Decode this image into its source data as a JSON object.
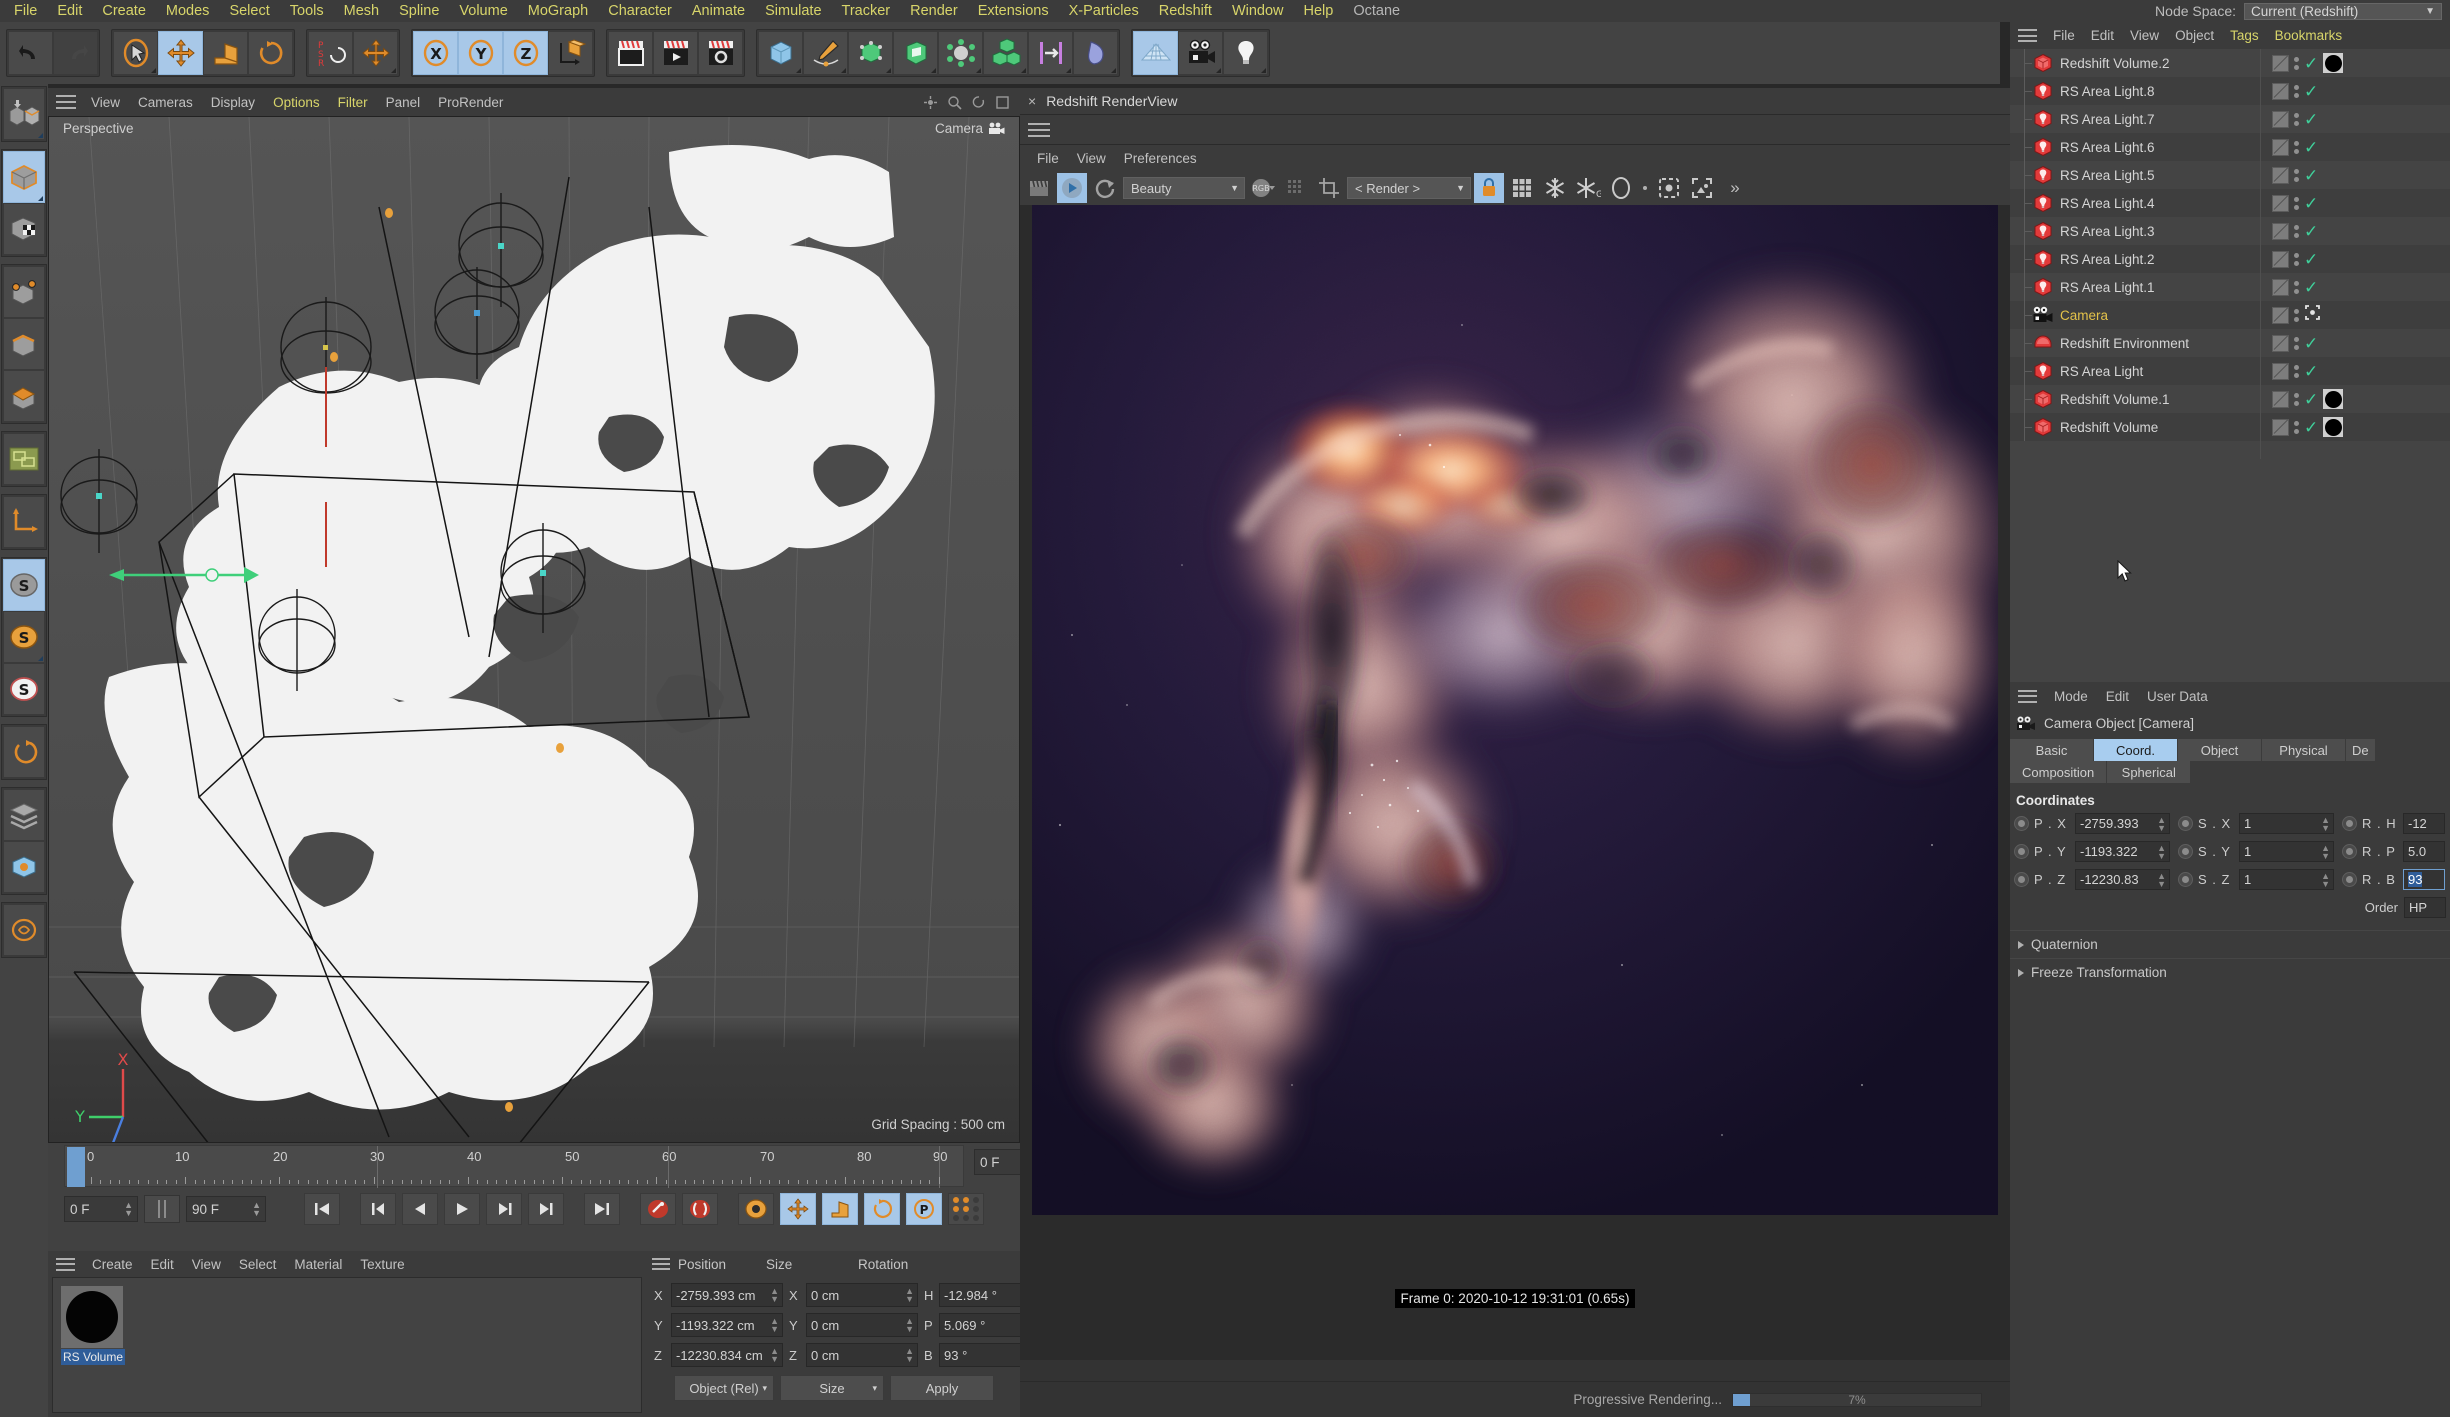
{
  "menubar": {
    "items": [
      "File",
      "Edit",
      "Create",
      "Modes",
      "Select",
      "Tools",
      "Mesh",
      "Spline",
      "Volume",
      "MoGraph",
      "Character",
      "Animate",
      "Simulate",
      "Tracker",
      "Render",
      "Extensions",
      "X-Particles",
      "Redshift",
      "Window",
      "Help",
      "Octane"
    ],
    "node_space_label": "Node Space:",
    "node_space_value": "Current (Redshift)"
  },
  "viewport": {
    "menu": [
      "View",
      "Cameras",
      "Display",
      "Options",
      "Filter",
      "Panel",
      "ProRender"
    ],
    "projection": "Perspective",
    "camera": "Camera",
    "grid_spacing": "Grid Spacing : 500 cm",
    "axis_x": "X",
    "axis_y": "Y",
    "axis_z": "Z"
  },
  "timeline": {
    "ticks": [
      "0",
      "10",
      "20",
      "30",
      "40",
      "50",
      "60",
      "70",
      "80",
      "90"
    ],
    "current_frame_right": "0 F",
    "start_frame": "0 F",
    "end_frame": "90 F"
  },
  "material_manager": {
    "menu": [
      "Create",
      "Edit",
      "View",
      "Select",
      "Material",
      "Texture"
    ],
    "materials": [
      {
        "name": "RS Volume",
        "color": "#040404"
      }
    ]
  },
  "coordinate_manager": {
    "headers": [
      "Position",
      "Size",
      "Rotation"
    ],
    "rows": [
      {
        "axis": "X",
        "position": "-2759.393 cm",
        "size_axis": "X",
        "size": "0 cm",
        "rot_axis": "H",
        "rotation": "-12.984 °"
      },
      {
        "axis": "Y",
        "position": "-1193.322 cm",
        "size_axis": "Y",
        "size": "0 cm",
        "rot_axis": "P",
        "rotation": "5.069 °"
      },
      {
        "axis": "Z",
        "position": "-12230.834 cm",
        "size_axis": "Z",
        "size": "0 cm",
        "rot_axis": "B",
        "rotation": "93 °"
      }
    ],
    "mode": "Object (Rel)",
    "size_mode": "Size",
    "apply_label": "Apply"
  },
  "renderview": {
    "tab_title": "Redshift RenderView",
    "close_label": "×",
    "menu": [
      "File",
      "View",
      "Preferences"
    ],
    "aov_value": "Beauty",
    "channel_value": "RGB",
    "region_value": "< Render >",
    "overflow_label": "»",
    "frame_info": "Frame 0:  2020-10-12 19:31:01 (0.65s)",
    "status_label": "Progressive Rendering...",
    "progress_percent": "7%"
  },
  "object_manager": {
    "menu": [
      "File",
      "Edit",
      "View",
      "Object",
      "Tags",
      "Bookmarks"
    ],
    "items": [
      {
        "name": "Redshift Volume.2",
        "icon": "volume-icon",
        "selected": false,
        "has_material": true,
        "tag": "check"
      },
      {
        "name": "RS Area Light.8",
        "icon": "light-icon",
        "selected": false,
        "has_material": false,
        "tag": "check"
      },
      {
        "name": "RS Area Light.7",
        "icon": "light-icon",
        "selected": false,
        "has_material": false,
        "tag": "check"
      },
      {
        "name": "RS Area Light.6",
        "icon": "light-icon",
        "selected": false,
        "has_material": false,
        "tag": "check"
      },
      {
        "name": "RS Area Light.5",
        "icon": "light-icon",
        "selected": false,
        "has_material": false,
        "tag": "check"
      },
      {
        "name": "RS Area Light.4",
        "icon": "light-icon",
        "selected": false,
        "has_material": false,
        "tag": "check"
      },
      {
        "name": "RS Area Light.3",
        "icon": "light-icon",
        "selected": false,
        "has_material": false,
        "tag": "check"
      },
      {
        "name": "RS Area Light.2",
        "icon": "light-icon",
        "selected": false,
        "has_material": false,
        "tag": "check"
      },
      {
        "name": "RS Area Light.1",
        "icon": "light-icon",
        "selected": false,
        "has_material": false,
        "tag": "check"
      },
      {
        "name": "Camera",
        "icon": "camera-icon",
        "selected": true,
        "has_material": false,
        "tag": "target"
      },
      {
        "name": "Redshift Environment",
        "icon": "environment-icon",
        "selected": false,
        "has_material": false,
        "tag": "check"
      },
      {
        "name": "RS Area Light",
        "icon": "light-icon",
        "selected": false,
        "has_material": false,
        "tag": "check"
      },
      {
        "name": "Redshift Volume.1",
        "icon": "volume-icon",
        "selected": false,
        "has_material": true,
        "tag": "check"
      },
      {
        "name": "Redshift Volume",
        "icon": "volume-icon",
        "selected": false,
        "has_material": true,
        "tag": "check"
      }
    ]
  },
  "attribute_manager": {
    "menu": [
      "Mode",
      "Edit",
      "User Data"
    ],
    "object_title": "Camera Object [Camera]",
    "tabs_row1": [
      "Basic",
      "Coord.",
      "Object",
      "Physical",
      "De"
    ],
    "tabs_row2": [
      "Composition",
      "Spherical"
    ],
    "active_tab": "Coord.",
    "section_title": "Coordinates",
    "rows": [
      {
        "p_label": "P . X",
        "p_value": "-2759.393",
        "s_label": "S . X",
        "s_value": "1",
        "r_label": "R . H",
        "r_value": "-12"
      },
      {
        "p_label": "P . Y",
        "p_value": "-1193.322",
        "s_label": "S . Y",
        "s_value": "1",
        "r_label": "R . P",
        "r_value": "5.0"
      },
      {
        "p_label": "P . Z",
        "p_value": "-12230.83",
        "s_label": "S . Z",
        "s_value": "1",
        "r_label": "R . B",
        "r_value": "93"
      }
    ],
    "order_label": "Order",
    "order_value": "HP",
    "folds": [
      "Quaternion",
      "Freeze Transformation"
    ]
  },
  "colors": {
    "accent_blue": "#a8c8e8",
    "orange": "#e08b2a",
    "green_check": "#3fcf9a",
    "red_icon": "#e03a3a",
    "menu_yellow": "#d8d56a"
  }
}
